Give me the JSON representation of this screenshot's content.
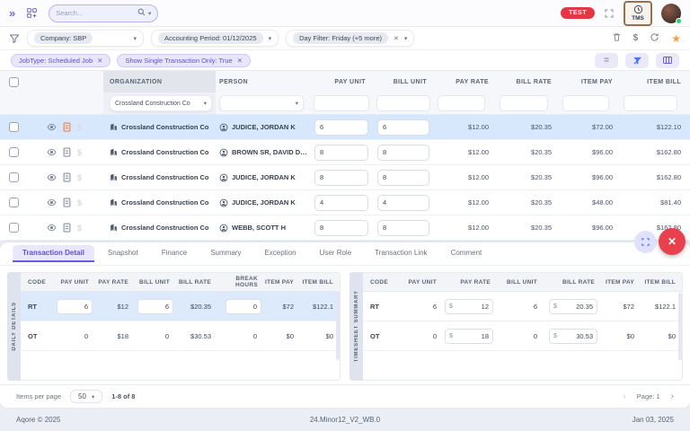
{
  "topbar": {
    "search_placeholder": "Search...",
    "test_badge": "TEST",
    "tms_label": "TMS"
  },
  "filterbar": {
    "company": "Company: SBP",
    "accounting_period": "Accounting Period: 01/12/2025",
    "day_filter": "Day Filter: Friday (+5 more)",
    "chips": [
      {
        "label": "JobType: Scheduled Job"
      },
      {
        "label": "Show Single Transaction Only: True"
      }
    ]
  },
  "table": {
    "columns": [
      "ORGANIZATION",
      "PERSON",
      "PAY UNIT",
      "BILL UNIT",
      "PAY RATE",
      "BILL RATE",
      "ITEM PAY",
      "ITEM BILL"
    ],
    "org_filter_value": "Crossland Construction Co",
    "rows": [
      {
        "org": "Crossland Construction Co",
        "person": "JUDICE, JORDAN K",
        "pay_unit": "6",
        "bill_unit": "6",
        "pay_rate": "$12.00",
        "bill_rate": "$20.35",
        "item_pay": "$72.00",
        "item_bill": "$122.10",
        "selected": true
      },
      {
        "org": "Crossland Construction Co",
        "person": "BROWN SR, DAVID DUDL...",
        "pay_unit": "8",
        "bill_unit": "8",
        "pay_rate": "$12.00",
        "bill_rate": "$20.35",
        "item_pay": "$96.00",
        "item_bill": "$162.80"
      },
      {
        "org": "Crossland Construction Co",
        "person": "JUDICE, JORDAN K",
        "pay_unit": "8",
        "bill_unit": "8",
        "pay_rate": "$12.00",
        "bill_rate": "$20.35",
        "item_pay": "$96.00",
        "item_bill": "$162.80"
      },
      {
        "org": "Crossland Construction Co",
        "person": "JUDICE, JORDAN K",
        "pay_unit": "4",
        "bill_unit": "4",
        "pay_rate": "$12.00",
        "bill_rate": "$20.35",
        "item_pay": "$48.00",
        "item_bill": "$81.40"
      },
      {
        "org": "Crossland Construction Co",
        "person": "WEBB, SCOTT H",
        "pay_unit": "8",
        "bill_unit": "8",
        "pay_rate": "$12.00",
        "bill_rate": "$20.35",
        "item_pay": "$96.00",
        "item_bill": "$162.80"
      }
    ]
  },
  "detail": {
    "tabs": [
      {
        "label": "Transaction Detail",
        "active": true
      },
      {
        "label": "Snapshot"
      },
      {
        "label": "Finance"
      },
      {
        "label": "Summary"
      },
      {
        "label": "Exception"
      },
      {
        "label": "User Role"
      },
      {
        "label": "Transaction Link"
      },
      {
        "label": "Comment"
      }
    ],
    "daily": {
      "label": "DAILY DETAILS",
      "columns": [
        "CODE",
        "PAY UNIT",
        "PAY RATE",
        "BILL UNIT",
        "BILL RATE",
        "BREAK HOURS",
        "ITEM PAY",
        "ITEM BILL"
      ],
      "rows": [
        {
          "code": "RT",
          "pay_unit": "6",
          "pay_rate": "$12",
          "bill_unit": "6",
          "bill_rate": "$20.35",
          "break_hours": "0",
          "item_pay": "$72",
          "item_bill": "$122.1",
          "selected": true
        },
        {
          "code": "OT",
          "pay_unit": "0",
          "pay_rate": "$18",
          "bill_unit": "0",
          "bill_rate": "$30.53",
          "break_hours": "0",
          "item_pay": "$0",
          "item_bill": "$0",
          "plain": true
        }
      ]
    },
    "summary": {
      "label": "TIMESHEET SUMMARY",
      "columns": [
        "CODE",
        "PAY UNIT",
        "PAY RATE",
        "BILL UNIT",
        "BILL RATE",
        "ITEM PAY",
        "ITEM BILL"
      ],
      "currency": "$",
      "rows": [
        {
          "code": "RT",
          "pay_unit": "6",
          "pay_rate": "12",
          "bill_unit": "6",
          "bill_rate": "20.35",
          "item_pay": "$72",
          "item_bill": "$122.1"
        },
        {
          "code": "OT",
          "pay_unit": "0",
          "pay_rate": "18",
          "bill_unit": "0",
          "bill_rate": "30.53",
          "item_pay": "$0",
          "item_bill": "$0"
        }
      ]
    },
    "pagination": {
      "items_label": "Items per page",
      "page_size": "50",
      "range": "1-8 of 8",
      "page": "Page: 1"
    }
  },
  "footer": {
    "left": "Aqore © 2025",
    "center": "24.Minor12_V2_WB.0",
    "right": "Jan 03, 2025"
  }
}
